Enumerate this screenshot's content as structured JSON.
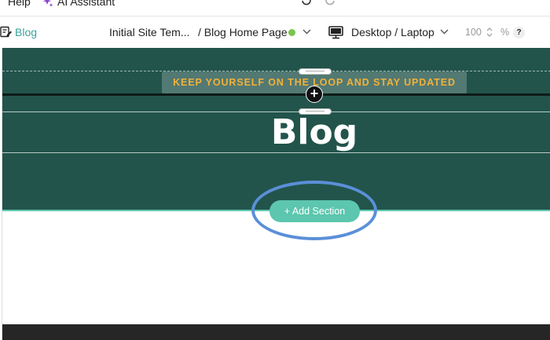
{
  "menubar": {
    "help": "Help",
    "ai_assistant": "AI Assistant"
  },
  "toolbar": {
    "blog_label": "Blog",
    "site_name": "Initial Site Tem...",
    "page_name": "/ Blog Home Page",
    "device": "Desktop / Laptop",
    "zoom_value": "100",
    "zoom_unit": "%",
    "help_glyph": "?"
  },
  "canvas": {
    "banner_text": "KEEP YOURSELF ON THE LOOP AND STAY UPDATED",
    "add_glyph": "+",
    "hero_title": "Blog",
    "add_section_label": "+ Add Section"
  },
  "colors": {
    "accent": "#3aa39a",
    "hero_bg": "#22544b",
    "banner_text": "#f2b13a",
    "add_section_bg": "#5cc6ae",
    "annotation_ring": "#5b8fd8",
    "status_dot": "#7cc44a"
  }
}
